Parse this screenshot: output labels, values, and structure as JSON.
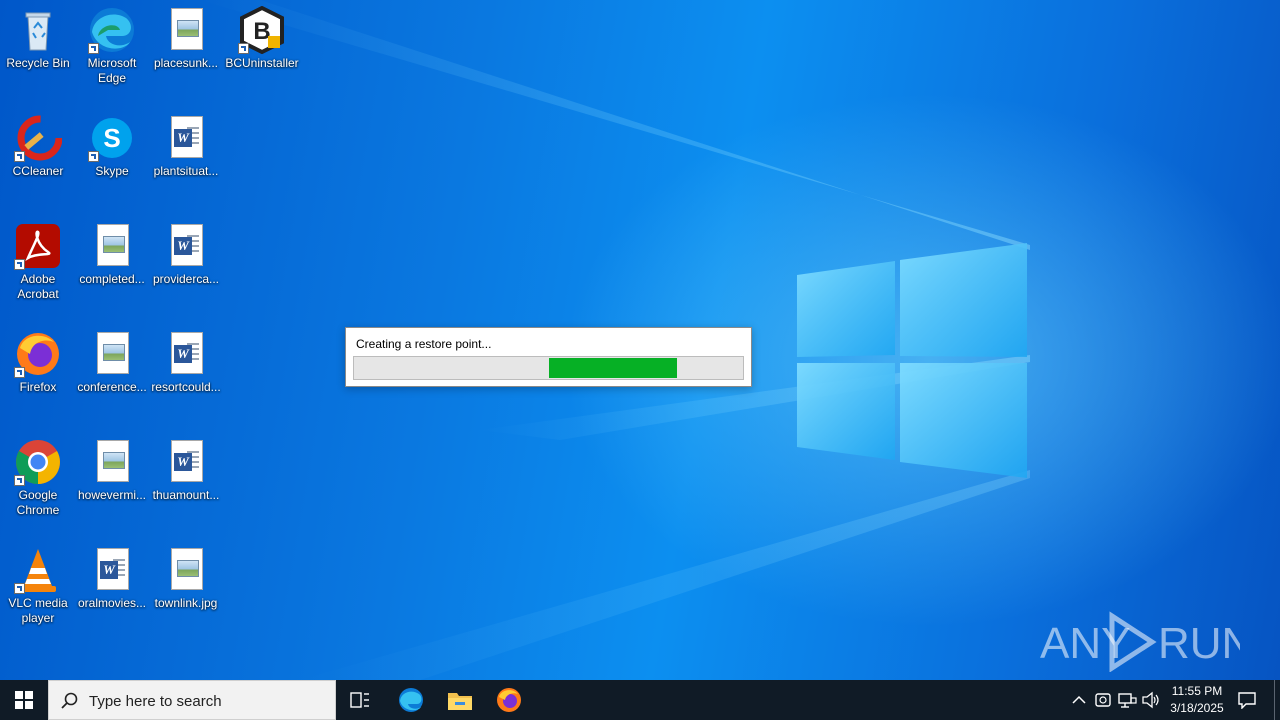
{
  "desktop": {
    "icons": [
      {
        "label": "Recycle Bin"
      },
      {
        "label": "Microsoft Edge"
      },
      {
        "label": "placesunk..."
      },
      {
        "label": "BCUninstaller"
      },
      {
        "label": "CCleaner"
      },
      {
        "label": "Skype"
      },
      {
        "label": "plantsituat..."
      },
      {
        "label": "Adobe Acrobat"
      },
      {
        "label": "completed..."
      },
      {
        "label": "providerca..."
      },
      {
        "label": "Firefox"
      },
      {
        "label": "conference..."
      },
      {
        "label": "resortcould..."
      },
      {
        "label": "Google Chrome"
      },
      {
        "label": "howevermi..."
      },
      {
        "label": "thuamount..."
      },
      {
        "label": "VLC media player"
      },
      {
        "label": "oralmovies..."
      },
      {
        "label": "townlink.jpg"
      }
    ]
  },
  "dialog": {
    "message": "Creating a restore point...",
    "progress_start": 0.5,
    "progress_end": 0.83
  },
  "watermark": {
    "text": "ANY RUN"
  },
  "taskbar": {
    "search_placeholder": "Type here to search",
    "time": "11:55 PM",
    "date": "3/18/2025"
  },
  "colors": {
    "progress": "#06b025",
    "taskbar": "#101b26",
    "word": "#2b579a"
  }
}
